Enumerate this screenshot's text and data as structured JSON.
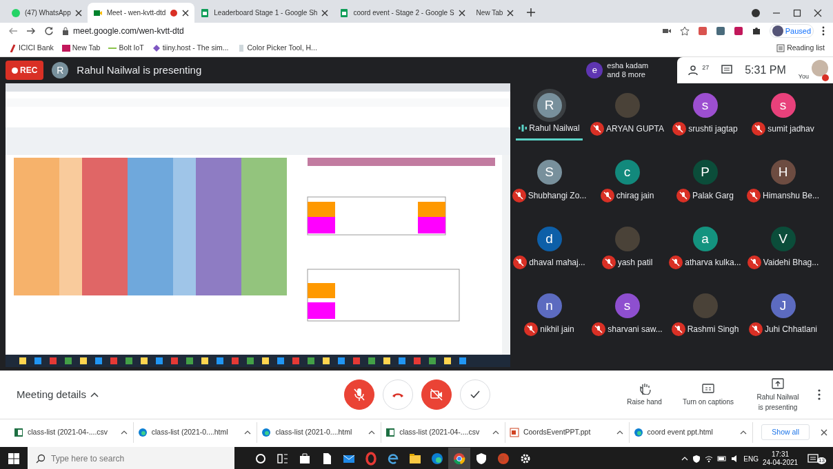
{
  "browser": {
    "tabs": [
      {
        "title": "(47) WhatsApp",
        "kind": "whatsapp",
        "selected": false,
        "recording": false
      },
      {
        "title": "Meet - wen-kvtt-dtd",
        "kind": "meet",
        "selected": true,
        "recording": true
      },
      {
        "title": "Leaderboard Stage 1 - Google Sh",
        "kind": "sheets",
        "selected": false,
        "recording": false
      },
      {
        "title": "coord event - Stage 2 - Google S",
        "kind": "sheets",
        "selected": false,
        "recording": false
      },
      {
        "title": "New Tab",
        "kind": "newtab",
        "selected": false,
        "recording": false
      }
    ],
    "address": "meet.google.com/wen-kvtt-dtd",
    "profile_status": "Paused",
    "bookmarks": [
      {
        "label": "ICICI Bank",
        "kind": "icici"
      },
      {
        "label": "New Tab",
        "kind": "newtab"
      },
      {
        "label": "Bolt IoT",
        "kind": "bolt"
      },
      {
        "label": "tiiny.host - The sim...",
        "kind": "tiiny"
      },
      {
        "label": "Color Picker Tool, H...",
        "kind": "picker"
      }
    ],
    "reading_list": "Reading list"
  },
  "meet": {
    "rec": "REC",
    "presenter_initial": "R",
    "presenting_text": "Rahul Nailwal is presenting",
    "others": {
      "initial": "e",
      "name": "esha kadam",
      "more": "and 8 more"
    },
    "people_count": "27",
    "time": "5:31 PM",
    "self_label": "You",
    "participants": [
      {
        "name": "Rahul Nailwal",
        "initial": "R",
        "color": "#78909c",
        "kind": "letter",
        "muted": false,
        "speaking": true
      },
      {
        "name": "ARYAN GUPTA",
        "kind": "photo",
        "muted": true,
        "speaking": false
      },
      {
        "name": "srushti jagtap",
        "initial": "s",
        "color": "#9c4fd0",
        "kind": "letter",
        "muted": true,
        "speaking": false
      },
      {
        "name": "sumit jadhav",
        "initial": "s",
        "color": "#e8417b",
        "kind": "letter",
        "muted": true,
        "speaking": false
      },
      {
        "name": "Shubhangi Zo...",
        "initial": "S",
        "color": "#78909c",
        "kind": "letter",
        "muted": true,
        "speaking": false
      },
      {
        "name": "chirag jain",
        "initial": "c",
        "color": "#12897c",
        "kind": "letter",
        "muted": true,
        "speaking": false
      },
      {
        "name": "Palak Garg",
        "initial": "P",
        "color": "#0b4d3a",
        "kind": "letter",
        "muted": true,
        "speaking": false
      },
      {
        "name": "Himanshu Be...",
        "initial": "H",
        "color": "#6d4c41",
        "kind": "letter",
        "muted": true,
        "speaking": false
      },
      {
        "name": "dhaval mahaj...",
        "initial": "d",
        "color": "#0d5fa8",
        "kind": "letter",
        "muted": true,
        "speaking": false
      },
      {
        "name": "yash patil",
        "kind": "photo",
        "muted": true,
        "speaking": false
      },
      {
        "name": "atharva kulka...",
        "initial": "a",
        "color": "#14937f",
        "kind": "letter",
        "muted": true,
        "speaking": false
      },
      {
        "name": "Vaidehi Bhag...",
        "initial": "V",
        "color": "#0b4d3a",
        "kind": "letter",
        "muted": true,
        "speaking": false
      },
      {
        "name": "nikhil jain",
        "initial": "n",
        "color": "#5c6bc0",
        "kind": "letter",
        "muted": true,
        "speaking": false
      },
      {
        "name": "sharvani saw...",
        "initial": "s",
        "color": "#8e4fcf",
        "kind": "letter",
        "muted": true,
        "speaking": false
      },
      {
        "name": "Rashmi Singh",
        "kind": "photo",
        "muted": true,
        "speaking": false
      },
      {
        "name": "Juhi Chhatlani",
        "initial": "J",
        "color": "#5c6bc0",
        "kind": "letter",
        "muted": true,
        "speaking": false
      }
    ],
    "meeting_details": "Meeting details",
    "controls": [
      {
        "kind": "mic",
        "on": false
      },
      {
        "kind": "hangup"
      },
      {
        "kind": "camera",
        "on": false
      },
      {
        "kind": "check"
      }
    ],
    "actions": [
      {
        "kind": "hand",
        "label": "Raise hand"
      },
      {
        "kind": "captions",
        "label": "Turn on captions"
      },
      {
        "kind": "present",
        "label": "Rahul Nailwal is presenting"
      }
    ]
  },
  "downloads": {
    "items": [
      {
        "name": "class-list (2021-04-....csv",
        "kind": "excel"
      },
      {
        "name": "class-list (2021-0....html",
        "kind": "edge"
      },
      {
        "name": "class-list (2021-0....html",
        "kind": "edge"
      },
      {
        "name": "class-list (2021-04-....csv",
        "kind": "excel"
      },
      {
        "name": "CoordsEventPPT.ppt",
        "kind": "ppt"
      },
      {
        "name": "coord event ppt.html",
        "kind": "edge"
      }
    ],
    "show_all": "Show all"
  },
  "taskbar": {
    "search_placeholder": "Type here to search",
    "language": "ENG",
    "time": "17:31",
    "date": "24-04-2021",
    "notifications": "13"
  }
}
